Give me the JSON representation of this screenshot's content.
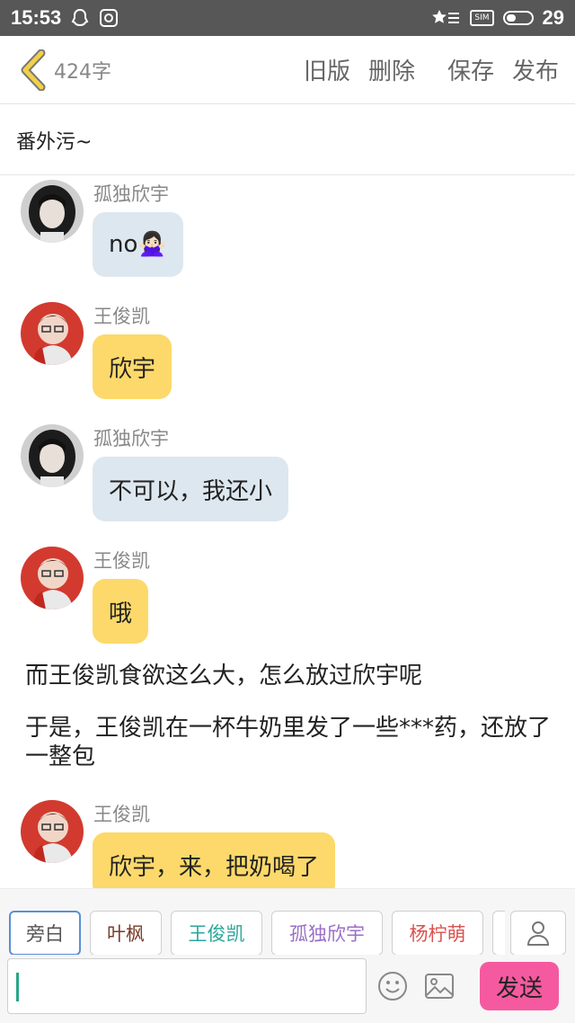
{
  "status_bar": {
    "time": "15:53",
    "sim_label": "SIM",
    "battery": "29"
  },
  "toolbar": {
    "word_count": "424字",
    "old_version": "旧版",
    "delete": "删除",
    "save": "保存",
    "publish": "发布"
  },
  "title": "番外污~",
  "messages": [
    {
      "type": "chat",
      "speaker": "孤独欣宇",
      "text": "no🙅🏻‍♀️",
      "bubble_color": "#dde7ef"
    },
    {
      "type": "chat",
      "speaker": "王俊凯",
      "text": "欣宇",
      "bubble_color": "#fcd96a"
    },
    {
      "type": "chat",
      "speaker": "孤独欣宇",
      "text": "不可以，我还小",
      "bubble_color": "#dde7ef"
    },
    {
      "type": "chat",
      "speaker": "王俊凯",
      "text": "哦",
      "bubble_color": "#fcd96a"
    },
    {
      "type": "narration",
      "text": "而王俊凯食欲这么大，怎么放过欣宇呢"
    },
    {
      "type": "narration",
      "text": "于是，王俊凯在一杯牛奶里发了一些***药，还放了一整包"
    },
    {
      "type": "chat",
      "speaker": "王俊凯",
      "text": "欣宇，来，把奶喝了",
      "bubble_color": "#fcd96a"
    }
  ],
  "characters": [
    {
      "label": "旁白",
      "color": "#555555",
      "selected": true
    },
    {
      "label": "叶枫",
      "color": "#7a3b2a",
      "selected": false
    },
    {
      "label": "王俊凯",
      "color": "#2aa79b",
      "selected": false
    },
    {
      "label": "孤独欣宇",
      "color": "#9b6fc7",
      "selected": false
    },
    {
      "label": "杨柠萌",
      "color": "#d9534f",
      "selected": false
    }
  ],
  "input": {
    "value": "",
    "placeholder": ""
  },
  "send_label": "发送",
  "icons": {
    "back": "chevron-left-icon",
    "emoji": "smiley-icon",
    "image": "image-icon",
    "character": "person-icon"
  },
  "colors": {
    "send_button": "#f55aa0",
    "back_chevron": "#f2d048",
    "speaker_yellow": "#fcd96a",
    "speaker_blue": "#dde7ef"
  }
}
